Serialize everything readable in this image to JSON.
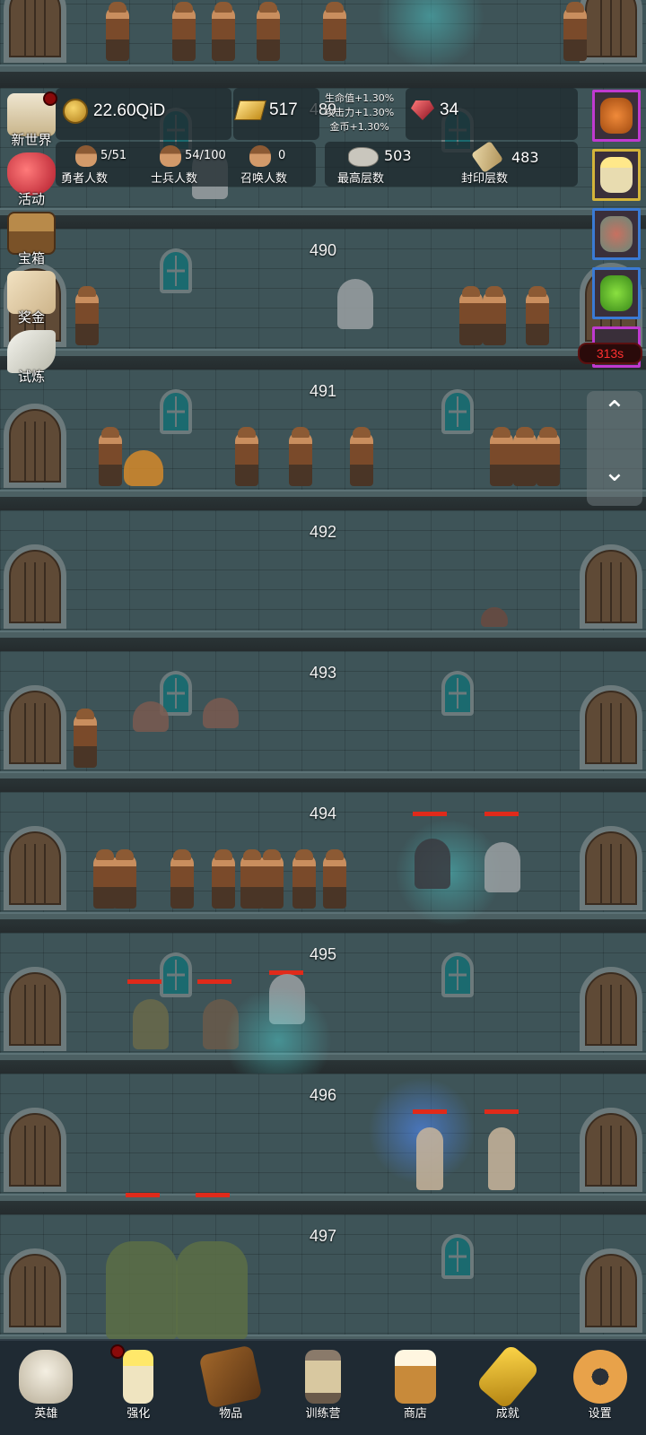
{
  "floors": [
    {
      "number": "489"
    },
    {
      "number": "490"
    },
    {
      "number": "491"
    },
    {
      "number": "492"
    },
    {
      "number": "493"
    },
    {
      "number": "494"
    },
    {
      "number": "495"
    },
    {
      "number": "496"
    },
    {
      "number": "497"
    }
  ],
  "hud": {
    "coins": "22.60QiD",
    "gold_bars": "517",
    "gems": "34",
    "bonus_hp": "生命值+1.30%",
    "bonus_atk": "攻击力+1.30%",
    "bonus_coin": "金币+1.30%",
    "heroes_count": "5/51",
    "heroes_label": "勇者人数",
    "soldiers_count": "54/100",
    "soldiers_label": "士兵人数",
    "summons_count": "0",
    "summons_label": "召唤人数",
    "max_floor_value": "503",
    "max_floor_label": "最高层数",
    "sealed_floor_value": "483",
    "sealed_floor_label": "封印层数"
  },
  "left_menu": [
    {
      "label": "新世界",
      "icon": "map-icon"
    },
    {
      "label": "活动",
      "icon": "heart-icon"
    },
    {
      "label": "宝箱",
      "icon": "chest-icon"
    },
    {
      "label": "奖金",
      "icon": "letter-icon"
    },
    {
      "label": "试炼",
      "icon": "feather-icon"
    }
  ],
  "right_buffs": {
    "timer": "313s"
  },
  "nav": [
    {
      "label": "英雄",
      "icon": "skull-icon"
    },
    {
      "label": "强化",
      "icon": "candle-icon"
    },
    {
      "label": "物品",
      "icon": "book-icon"
    },
    {
      "label": "训练营",
      "icon": "lantern-icon"
    },
    {
      "label": "商店",
      "icon": "beer-mug-icon"
    },
    {
      "label": "成就",
      "icon": "key-icon"
    },
    {
      "label": "设置",
      "icon": "gear-icon"
    }
  ],
  "colors": {
    "wall": "#3e5458",
    "hp_bar": "#e02a1a",
    "timer_text": "#ff3030",
    "nav_bg": "#1f2a33"
  }
}
